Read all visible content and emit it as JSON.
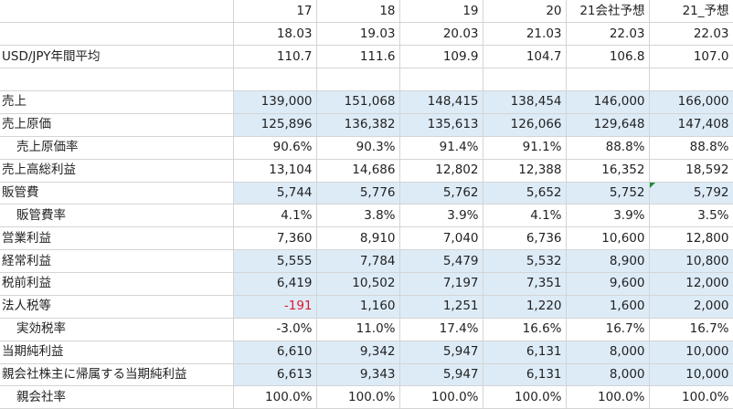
{
  "header_rows": [
    {
      "label": "",
      "cells": [
        "17",
        "18",
        "19",
        "20",
        "21会社予想",
        "21_予想"
      ]
    },
    {
      "label": "",
      "cells": [
        "18.03",
        "19.03",
        "20.03",
        "21.03",
        "22.03",
        "22.03"
      ]
    }
  ],
  "rows": [
    {
      "label": "USD/JPY年間平均",
      "indent": false,
      "highlight": false,
      "cells": [
        "110.7",
        "111.6",
        "109.9",
        "104.7",
        "106.8",
        "107.0"
      ]
    },
    {
      "label": "",
      "indent": false,
      "highlight": false,
      "cells": [
        "",
        "",
        "",
        "",
        "",
        ""
      ]
    },
    {
      "label": "売上",
      "indent": false,
      "highlight": true,
      "cells": [
        "139,000",
        "151,068",
        "148,415",
        "138,454",
        "146,000",
        "166,000"
      ]
    },
    {
      "label": "売上原価",
      "indent": false,
      "highlight": true,
      "cells": [
        "125,896",
        "136,382",
        "135,613",
        "126,066",
        "129,648",
        "147,408"
      ]
    },
    {
      "label": "売上原価率",
      "indent": true,
      "highlight": false,
      "cells": [
        "90.6%",
        "90.3%",
        "91.4%",
        "91.1%",
        "88.8%",
        "88.8%"
      ]
    },
    {
      "label": "売上高総利益",
      "indent": false,
      "highlight": false,
      "cells": [
        "13,104",
        "14,686",
        "12,802",
        "12,388",
        "16,352",
        "18,592"
      ]
    },
    {
      "label": "販管費",
      "indent": false,
      "highlight": true,
      "cells": [
        "5,744",
        "5,776",
        "5,762",
        "5,652",
        "5,752",
        "5,792"
      ]
    },
    {
      "label": "販管費率",
      "indent": true,
      "highlight": false,
      "cells": [
        "4.1%",
        "3.8%",
        "3.9%",
        "4.1%",
        "3.9%",
        "3.5%"
      ]
    },
    {
      "label": "営業利益",
      "indent": false,
      "highlight": false,
      "cells": [
        "7,360",
        "8,910",
        "7,040",
        "6,736",
        "10,600",
        "12,800"
      ]
    },
    {
      "label": "経常利益",
      "indent": false,
      "highlight": true,
      "cells": [
        "5,555",
        "7,784",
        "5,479",
        "5,532",
        "8,900",
        "10,800"
      ]
    },
    {
      "label": "税前利益",
      "indent": false,
      "highlight": true,
      "cells": [
        "6,419",
        "10,502",
        "7,197",
        "7,351",
        "9,600",
        "12,000"
      ]
    },
    {
      "label": "法人税等",
      "indent": false,
      "highlight": true,
      "cells": [
        "-191",
        "1,160",
        "1,251",
        "1,220",
        "1,600",
        "2,000"
      ]
    },
    {
      "label": "実効税率",
      "indent": true,
      "highlight": false,
      "cells": [
        "-3.0%",
        "11.0%",
        "17.4%",
        "16.6%",
        "16.7%",
        "16.7%"
      ]
    },
    {
      "label": "当期純利益",
      "indent": false,
      "highlight": true,
      "cells": [
        "6,610",
        "9,342",
        "5,947",
        "6,131",
        "8,000",
        "10,000"
      ]
    },
    {
      "label": "親会社株主に帰属する当期純利益",
      "indent": false,
      "highlight": true,
      "cells": [
        "6,613",
        "9,343",
        "5,947",
        "6,131",
        "8,000",
        "10,000"
      ]
    },
    {
      "label": "親会社率",
      "indent": true,
      "highlight": false,
      "cells": [
        "100.0%",
        "100.0%",
        "100.0%",
        "100.0%",
        "100.0%",
        "100.0%"
      ]
    }
  ],
  "colors": {
    "highlight_fill": "#ddebf7",
    "negative_text": "#e0162b",
    "gridline": "#d4d4d4",
    "comment_marker": "#1d8a3a"
  }
}
